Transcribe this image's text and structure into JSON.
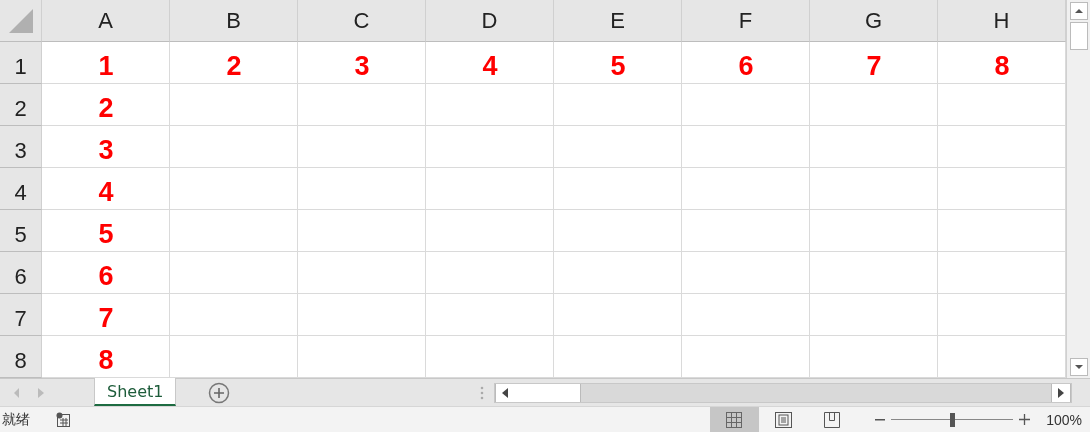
{
  "grid": {
    "columns": [
      "A",
      "B",
      "C",
      "D",
      "E",
      "F",
      "G",
      "H"
    ],
    "rows": [
      {
        "header": "1",
        "cells": [
          "1",
          "2",
          "3",
          "4",
          "5",
          "6",
          "7",
          "8"
        ]
      },
      {
        "header": "2",
        "cells": [
          "2"
        ]
      },
      {
        "header": "3",
        "cells": [
          "3"
        ]
      },
      {
        "header": "4",
        "cells": [
          "4"
        ]
      },
      {
        "header": "5",
        "cells": [
          "5"
        ]
      },
      {
        "header": "6",
        "cells": [
          "6"
        ]
      },
      {
        "header": "7",
        "cells": [
          "7"
        ]
      },
      {
        "header": "8",
        "cells": [
          "8"
        ]
      }
    ]
  },
  "sheet_tabs": [
    {
      "label": "Sheet1",
      "selected": true
    }
  ],
  "status_bar": {
    "status": "就绪",
    "views": [
      {
        "kind": "normal",
        "selected": true
      },
      {
        "kind": "page-layout",
        "selected": false
      },
      {
        "kind": "page-break",
        "selected": false
      }
    ],
    "zoom": {
      "level": 0.5,
      "reading": "100%"
    }
  }
}
